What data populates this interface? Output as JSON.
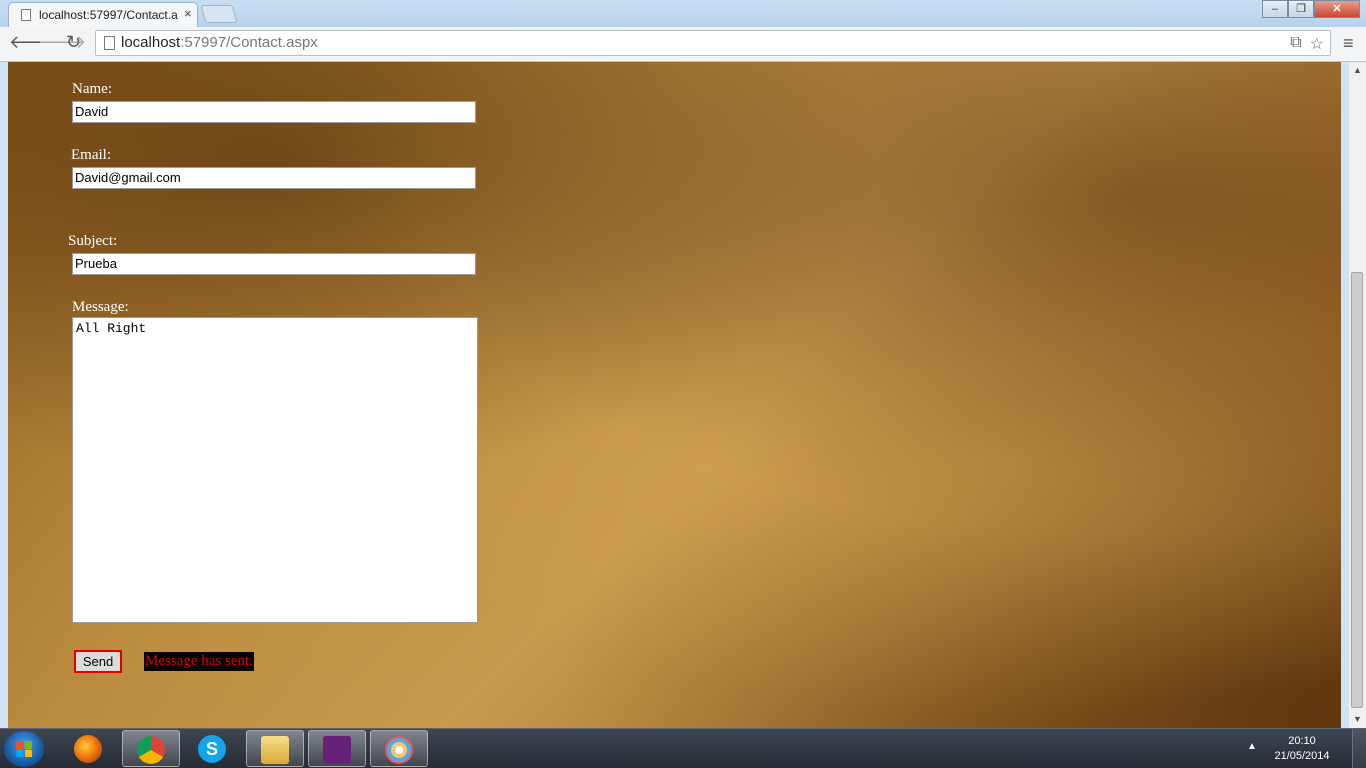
{
  "browser": {
    "tab_title": "localhost:57997/Contact.a",
    "tab_close": "×",
    "url_host": "localhost",
    "url_rest": ":57997/Contact.aspx",
    "back_icon": "arrow-left-icon",
    "forward_icon": "arrow-right-icon",
    "reload_icon": "reload-icon"
  },
  "form": {
    "name_label": "Name:",
    "name_value": "David",
    "email_label": "Email:",
    "email_value": "David@gmail.com",
    "subject_label": "Subject:",
    "subject_value": "Prueba",
    "message_label": "Message:",
    "message_value": "All Right",
    "send_label": "Send",
    "status_message": "Message has sent."
  },
  "taskbar": {
    "time": "20:10",
    "date": "21/05/2014",
    "apps": [
      "firefox",
      "chrome",
      "skype",
      "file-explorer",
      "visual-studio",
      "paint"
    ]
  },
  "colors": {
    "accent_error": "#e00000",
    "label_text": "#ffffff"
  }
}
